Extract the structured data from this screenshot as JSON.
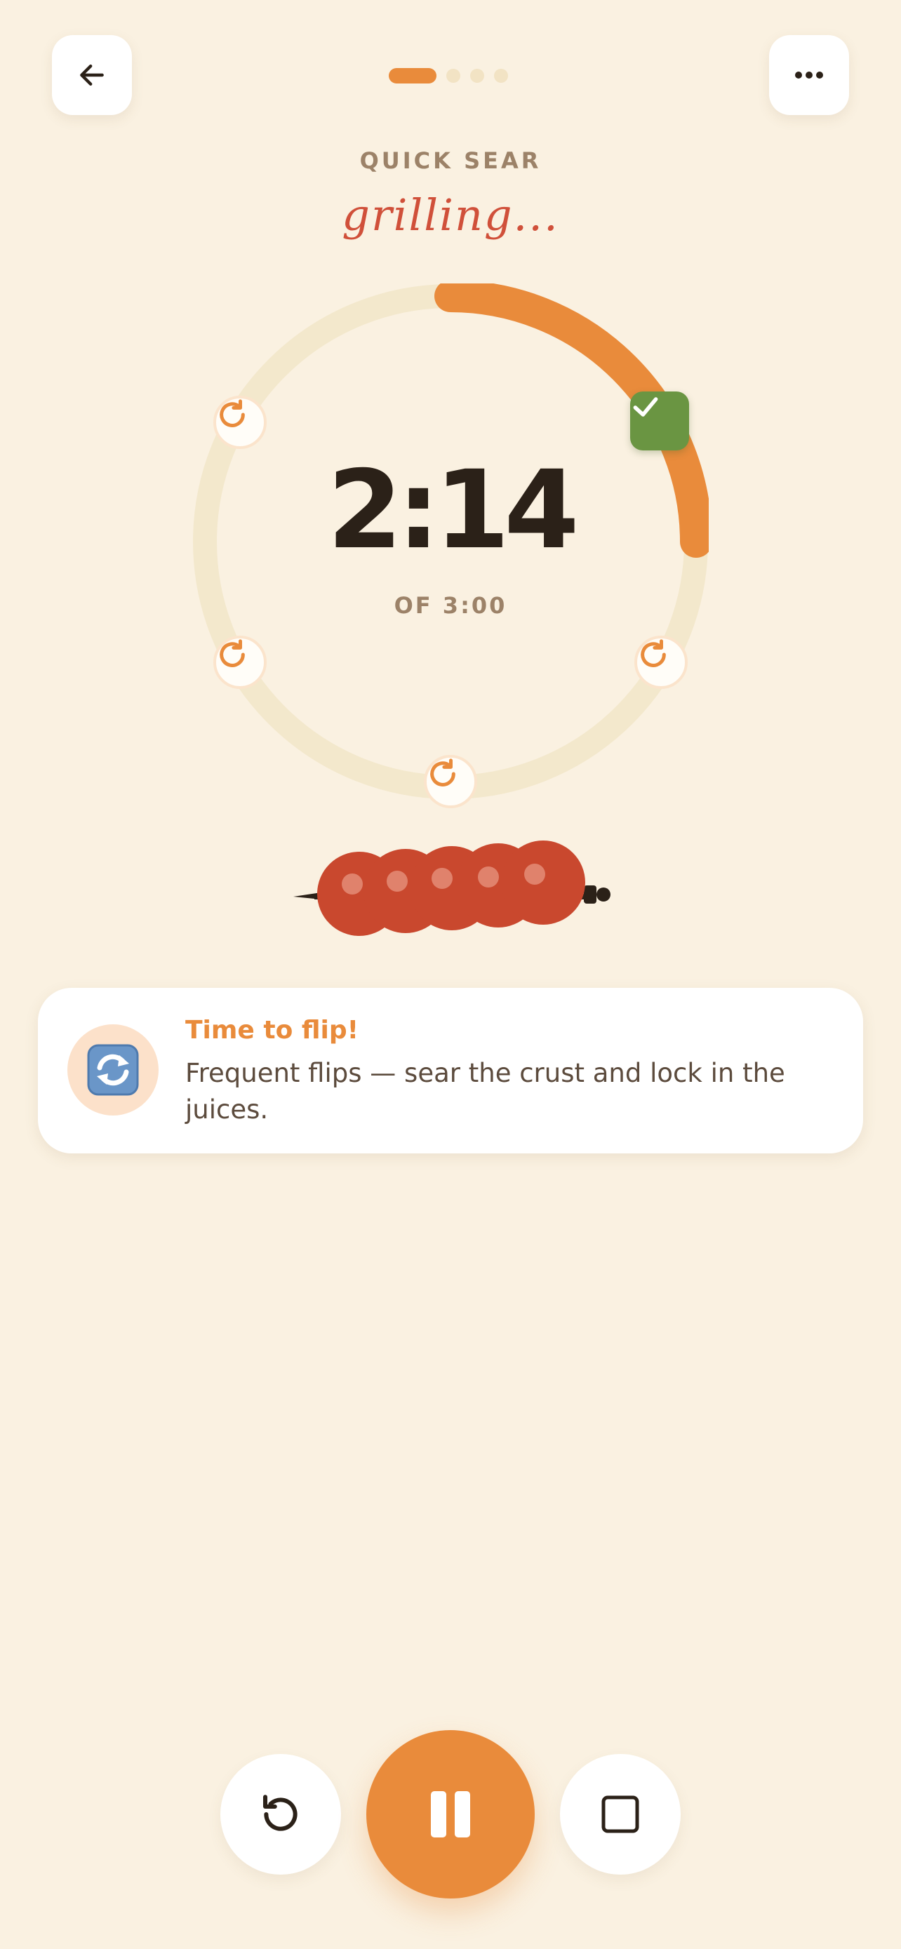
{
  "header": {
    "back_icon": "arrow-left-icon",
    "more_icon": "more-horizontal-icon",
    "step_count": 4,
    "active_step": 1
  },
  "session": {
    "preset_label": "QUICK SEAR",
    "status_text": "grilling..."
  },
  "timer": {
    "elapsed": "2:14",
    "total_label": "OF 3:00",
    "progress": 0.25,
    "flip_markers": [
      {
        "state": "done",
        "icon": "check-icon"
      },
      {
        "state": "pending",
        "icon": "refresh-icon"
      },
      {
        "state": "pending",
        "icon": "refresh-icon"
      },
      {
        "state": "pending",
        "icon": "refresh-icon"
      },
      {
        "state": "pending",
        "icon": "refresh-icon"
      }
    ]
  },
  "tip": {
    "icon": "flip-arrows-emoji",
    "title": "Time to flip!",
    "body": "Frequent flips — sear the crust and lock in the juices."
  },
  "controls": {
    "reset_icon": "restart-icon",
    "pause_icon": "pause-icon",
    "stop_icon": "stop-icon"
  },
  "colors": {
    "background": "#FAF1E1",
    "accent": "#E98B3B",
    "script": "#D0503A",
    "done": "#6A9542",
    "track": "#F3E8CC",
    "meat": "#C9482E"
  }
}
